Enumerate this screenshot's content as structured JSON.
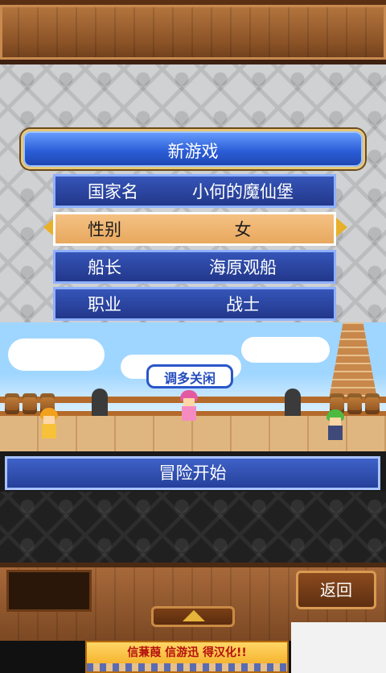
{
  "title": "新游戏",
  "form": {
    "rows": [
      {
        "label": "国家名",
        "value": "小何的魔仙堡"
      },
      {
        "label": "性别",
        "value": "女"
      },
      {
        "label": "船长",
        "value": "海原观船"
      },
      {
        "label": "职业",
        "value": "战士"
      }
    ]
  },
  "scene": {
    "speech_text": "调多关闲"
  },
  "buttons": {
    "start_label": "冒险开始",
    "back_label": "返回"
  },
  "footer": {
    "ad_text": "信蒹葭 信游迅 得汉化!!"
  },
  "colors": {
    "panel_blue": "#2c5ed8",
    "selected_row": "#f4c184",
    "accent_gold": "#e8b02a",
    "wood": "#8a5226"
  }
}
